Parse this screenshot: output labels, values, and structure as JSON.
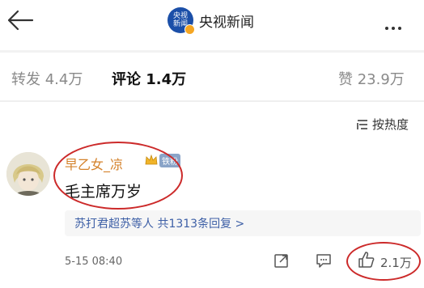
{
  "header": {
    "account_name": "央视新闻",
    "logo_lines": [
      "央视",
      "新闻"
    ]
  },
  "tabs": {
    "repost": "转发 4.4万",
    "comments": "评论 1.4万",
    "likes": "赞 23.9万"
  },
  "sort": {
    "label": "按热度"
  },
  "comment": {
    "username": "早乙女_凉",
    "fan_badge": "铁粉",
    "text": "毛主席万岁",
    "replies_summary": "苏打君超苏等人  共1313条回复 >",
    "timestamp": "5-15 08:40",
    "like_count": "2.1万"
  },
  "colors": {
    "username": "#d4822b",
    "link": "#3d5fa6",
    "annotation_circle": "#cc2a2a",
    "logo_bg": "#1b4fa8"
  },
  "icons": [
    "back-arrow-icon",
    "more-icon",
    "sort-icon",
    "share-icon",
    "reply-icon",
    "thumbs-up-icon"
  ]
}
